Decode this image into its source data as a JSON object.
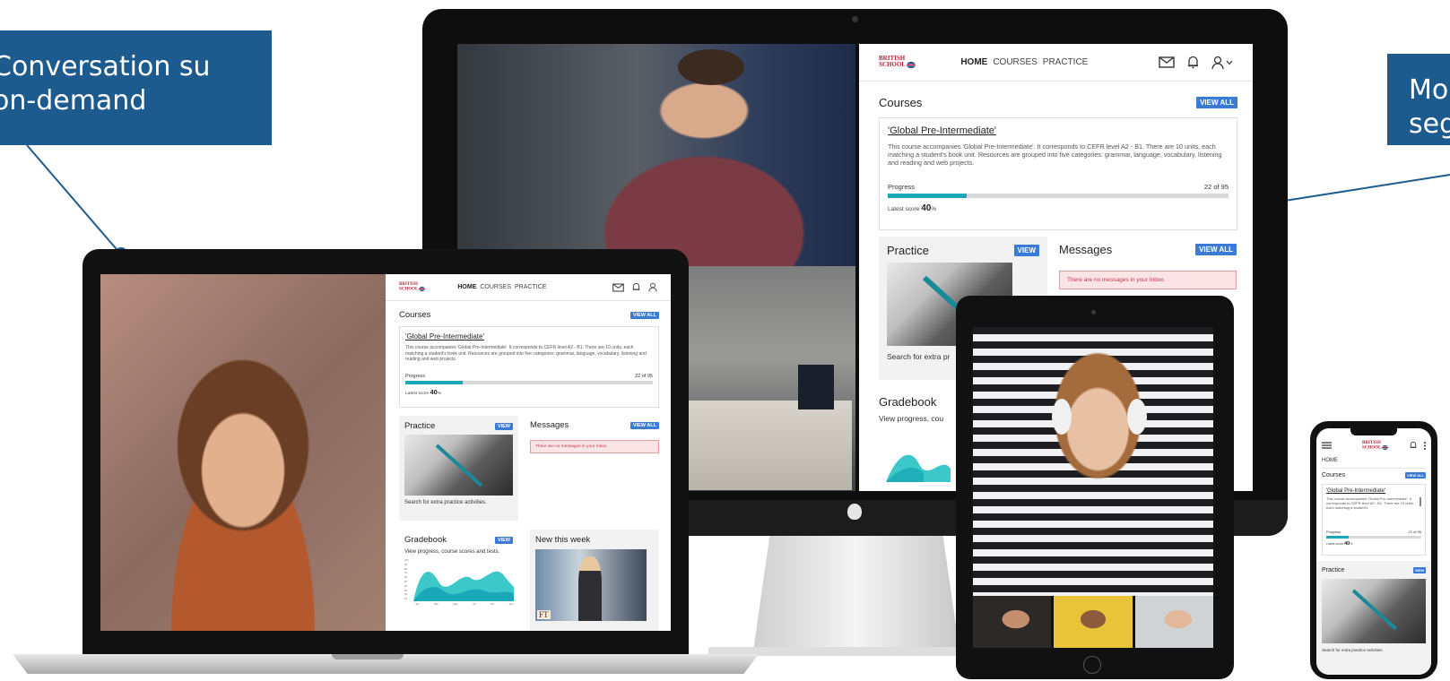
{
  "callouts": {
    "left_line1": "Conversation su",
    "left_line2": "on-demand",
    "right_line1": "Mo",
    "right_line2": "seg"
  },
  "app": {
    "logo_line1": "BRITISH",
    "logo_line2": "SCHOOL",
    "nav": {
      "home": "HOME",
      "courses": "COURSES",
      "practice": "PRACTICE"
    },
    "icons": {
      "mail": "mail-icon",
      "bell": "bell-icon",
      "user": "user-icon",
      "chevron": "chevron-down-icon",
      "menu": "menu-icon",
      "kebab": "more-icon"
    },
    "courses": {
      "title": "Courses",
      "view_all": "VIEW ALL",
      "course_name": "'Global Pre-Intermediate'",
      "description": "This course accompanies 'Global Pre-Intermediate'. It corresponds to CEFR level A2 - B1. There are 10 units, each matching a student's book unit. Resources are grouped into five categories: grammar, language, vocabulary, listening and reading and web projects.",
      "progress_label": "Progress",
      "progress_count": "22 of 95",
      "progress_fraction": 0.2316,
      "latest_label": "Latest score",
      "latest_value": "40",
      "latest_unit": "%"
    },
    "practice": {
      "title": "Practice",
      "view": "VIEW",
      "caption": "Search for extra practice activities."
    },
    "messages": {
      "title": "Messages",
      "view_all": "VIEW ALL",
      "empty": "There are no messages in your Inbox."
    },
    "gradebook": {
      "title": "Gradebook",
      "view": "VIEW",
      "caption": "View progress, course scores and tests.",
      "y_ticks": [
        "100",
        "90",
        "80",
        "70",
        "60",
        "50",
        "40",
        "30",
        "20",
        "10"
      ],
      "x_ticks": [
        "Jan",
        "Mar",
        "May",
        "Jul",
        "Oct",
        "Dec"
      ]
    },
    "new_this_week": {
      "title": "New this week",
      "ft": "FT"
    },
    "mobile": {
      "home": "HOME",
      "desc_short": "This course accompanies 'Global Pre-Intermediate'. It corresponds to CEFR level A2 - B1. There are 10 units, each matching a student's"
    },
    "monitor_partial": {
      "practice_caption": "Search for extra pr",
      "gradebook_caption": "View progress, cou"
    }
  },
  "colors": {
    "callout": "#1d5b8f",
    "badge": "#3a7bd5",
    "progress": "#1aa7b8",
    "chart_teal": "#3cc8c8"
  }
}
